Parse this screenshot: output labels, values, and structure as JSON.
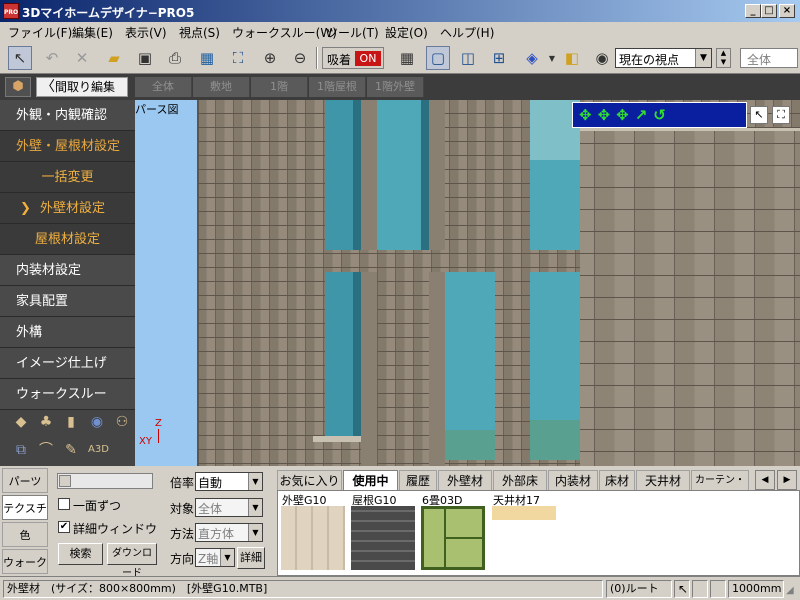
{
  "window": {
    "title": "3Dマイホームデザイナ−PRO5",
    "icon_text": "PRO",
    "controls": [
      "_",
      "□",
      "×"
    ]
  },
  "menu": [
    "ファイル(F)",
    "編集(E)",
    "表示(V)",
    "視点(S)",
    "ウォークスルー(W)",
    "ツール(T)",
    "設定(O)",
    "ヘルプ(H)"
  ],
  "toolbar": {
    "stick_label": "吸着",
    "stick_state": "ON",
    "viewpoint_value": "現在の視点",
    "scope_value": "全体"
  },
  "subbar": {
    "back_label": "間取り編集",
    "floor_tabs": [
      "全体",
      "敷地",
      "1階",
      "1階屋根",
      "1階外壁"
    ]
  },
  "nav": {
    "items": [
      {
        "label": "外観・内観確認"
      },
      {
        "label": "外壁・屋根材設定"
      },
      {
        "label": "一括変更"
      },
      {
        "label": "外壁材設定"
      },
      {
        "label": "屋根材設定"
      },
      {
        "label": "内装材設定"
      },
      {
        "label": "家具配置"
      },
      {
        "label": "外構"
      },
      {
        "label": "イメージ仕上げ"
      },
      {
        "label": "ウォークスルー"
      }
    ],
    "selected_marker": "❯"
  },
  "viewport": {
    "label": "パース図",
    "axis_z": "Z",
    "axis_xy": "XY"
  },
  "bottom": {
    "side_tabs": [
      "パーツ",
      "テクスチャ",
      "色",
      "ウォーク"
    ],
    "option_single": "一面ずつ",
    "option_detail": "詳細ウィンドウ",
    "option_detail_checked": "✔",
    "search_btn": "検索",
    "download_btn": "ダウンロード",
    "props": [
      {
        "label": "倍率",
        "value": "自動"
      },
      {
        "label": "対象",
        "value": "全体"
      },
      {
        "label": "方法",
        "value": "直方体"
      },
      {
        "label": "方向",
        "value": "Z軸"
      }
    ],
    "detail_btn": "詳細"
  },
  "material_tabs": [
    "お気に入り",
    "使用中",
    "履歴",
    "外壁材",
    "外部床",
    "内装材",
    "床材",
    "天井材",
    "カーテン・布"
  ],
  "materials": [
    {
      "name": "外壁G10",
      "color": "#d8ccb8"
    },
    {
      "name": "屋根G10",
      "color": "#555555"
    },
    {
      "name": "6畳03D",
      "color": "#a8c070"
    },
    {
      "name": "天井材17",
      "color": "#f0d8a0"
    }
  ],
  "status": {
    "info": "外壁材　(サイズ：800×800mm)　[外壁G10.MTB]",
    "root": "(0)ルート",
    "scale": "1000mm"
  },
  "colors": {
    "accent_on": "#c81414",
    "nav_active": "#e8a83e",
    "sky": "#9bc8f0",
    "wall": "#8c8273",
    "glass": "#4fa8b8"
  }
}
